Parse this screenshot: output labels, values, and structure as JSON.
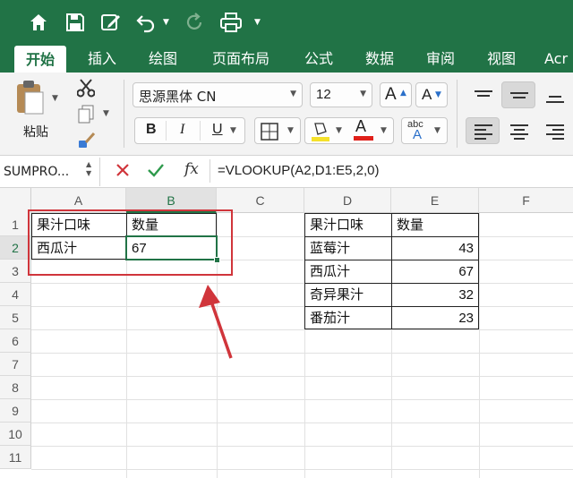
{
  "tabs": [
    "开始",
    "插入",
    "绘图",
    "页面布局",
    "公式",
    "数据",
    "审阅",
    "视图",
    "Acr"
  ],
  "ribbon": {
    "paste_label": "粘贴",
    "font_name": "思源黑体 CN",
    "font_size": "12",
    "bold": "B",
    "italic": "I",
    "underline": "U",
    "grow_font": "A",
    "shrink_font": "A",
    "font_color_letter": "A",
    "abc_label": "abc"
  },
  "formula_bar": {
    "name_box": "SUMPRO...",
    "fx_label": "fx",
    "formula": "=VLOOKUP(A2,D1:E5,2,0)"
  },
  "columns": [
    "A",
    "B",
    "C",
    "D",
    "E",
    "F"
  ],
  "rows": [
    "1",
    "2",
    "3",
    "4",
    "5",
    "6",
    "7",
    "8",
    "9",
    "10",
    "11"
  ],
  "cells": {
    "A1": "果汁口味",
    "B1": "数量",
    "A2": "西瓜汁",
    "B2": "67",
    "D1": "果汁口味",
    "E1": "数量",
    "D2": "蓝莓汁",
    "E2": "43",
    "D3": "西瓜汁",
    "E3": "67",
    "D4": "奇异果汁",
    "E4": "32",
    "D5": "番茄汁",
    "E5": "23"
  },
  "colors": {
    "brand": "#217346",
    "annotation": "#d0353b"
  }
}
